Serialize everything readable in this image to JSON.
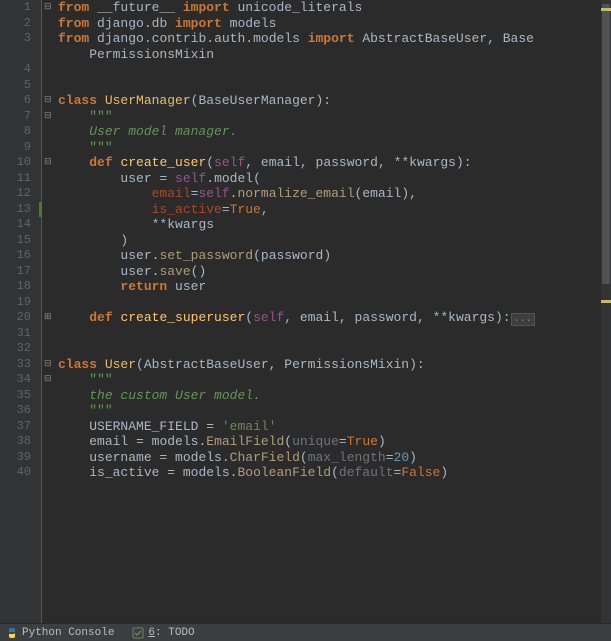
{
  "lines": [
    {
      "n": 1,
      "fold": "⊟",
      "tokens": [
        {
          "t": "from ",
          "c": "kw"
        },
        {
          "t": "__future__ ",
          "c": "ident"
        },
        {
          "t": "import ",
          "c": "kw"
        },
        {
          "t": "unicode_literals",
          "c": "ident"
        }
      ]
    },
    {
      "n": 2,
      "tokens": [
        {
          "t": "from ",
          "c": "kw"
        },
        {
          "t": "django",
          "c": "ident"
        },
        {
          "t": ".",
          "c": "dot"
        },
        {
          "t": "db ",
          "c": "ident"
        },
        {
          "t": "import ",
          "c": "kw"
        },
        {
          "t": "models",
          "c": "ident"
        }
      ]
    },
    {
      "n": 3,
      "tokens": [
        {
          "t": "from ",
          "c": "kw"
        },
        {
          "t": "django",
          "c": "ident"
        },
        {
          "t": ".",
          "c": "dot"
        },
        {
          "t": "contrib",
          "c": "ident"
        },
        {
          "t": ".",
          "c": "dot"
        },
        {
          "t": "auth",
          "c": "ident"
        },
        {
          "t": ".",
          "c": "dot"
        },
        {
          "t": "models ",
          "c": "ident"
        },
        {
          "t": "import ",
          "c": "kw"
        },
        {
          "t": "AbstractBaseUser",
          "c": "ident"
        },
        {
          "t": ", ",
          "c": "op"
        },
        {
          "t": "Base",
          "c": "ident"
        }
      ]
    },
    {
      "n": "",
      "indent": "    ",
      "tokens": [
        {
          "t": "PermissionsMixin",
          "c": "ident"
        }
      ]
    },
    {
      "n": 4,
      "tokens": []
    },
    {
      "n": 5,
      "tokens": []
    },
    {
      "n": 6,
      "fold": "⊟",
      "tokens": [
        {
          "t": "class ",
          "c": "kw"
        },
        {
          "t": "UserManager",
          "c": "cls-def"
        },
        {
          "t": "(",
          "c": "op"
        },
        {
          "t": "BaseUserManager",
          "c": "ident"
        },
        {
          "t": ")",
          "c": "op"
        },
        {
          "t": ":",
          "c": "op"
        }
      ]
    },
    {
      "n": 7,
      "fold": "⊟",
      "indent": "    ",
      "tokens": [
        {
          "t": "\"\"\"",
          "c": "docq"
        }
      ]
    },
    {
      "n": 8,
      "indent": "    ",
      "tokens": [
        {
          "t": "User model manager.",
          "c": "doc"
        }
      ]
    },
    {
      "n": 9,
      "indent": "    ",
      "tokens": [
        {
          "t": "\"\"\"",
          "c": "docq"
        }
      ]
    },
    {
      "n": 10,
      "fold": "⊟",
      "indent": "    ",
      "tokens": [
        {
          "t": "def ",
          "c": "kw"
        },
        {
          "t": "create_user",
          "c": "fn-def"
        },
        {
          "t": "(",
          "c": "op"
        },
        {
          "t": "self",
          "c": "self"
        },
        {
          "t": ", ",
          "c": "op"
        },
        {
          "t": "email",
          "c": "param"
        },
        {
          "t": ", ",
          "c": "op"
        },
        {
          "t": "password",
          "c": "param"
        },
        {
          "t": ", ",
          "c": "op"
        },
        {
          "t": "**",
          "c": "op"
        },
        {
          "t": "kwargs",
          "c": "param"
        },
        {
          "t": ")",
          "c": "op"
        },
        {
          "t": ":",
          "c": "op"
        }
      ]
    },
    {
      "n": 11,
      "indent": "        ",
      "tokens": [
        {
          "t": "user ",
          "c": "ident"
        },
        {
          "t": "= ",
          "c": "op"
        },
        {
          "t": "self",
          "c": "self"
        },
        {
          "t": ".",
          "c": "dot"
        },
        {
          "t": "model",
          "c": "ident"
        },
        {
          "t": "(",
          "c": "op"
        }
      ]
    },
    {
      "n": 12,
      "indent": "            ",
      "tokens": [
        {
          "t": "email",
          "c": "kwarg"
        },
        {
          "t": "=",
          "c": "op"
        },
        {
          "t": "self",
          "c": "self"
        },
        {
          "t": ".",
          "c": "dot"
        },
        {
          "t": "normalize_email",
          "c": "call"
        },
        {
          "t": "(",
          "c": "op"
        },
        {
          "t": "email",
          "c": "ident"
        },
        {
          "t": ")",
          "c": "op"
        },
        {
          "t": ",",
          "c": "op"
        }
      ]
    },
    {
      "n": 13,
      "change": true,
      "indent": "            ",
      "tokens": [
        {
          "t": "is_active",
          "c": "kwarg"
        },
        {
          "t": "=",
          "c": "op"
        },
        {
          "t": "True",
          "c": "kw-plain"
        },
        {
          "t": ",",
          "c": "op"
        }
      ]
    },
    {
      "n": 14,
      "indent": "            ",
      "tokens": [
        {
          "t": "**",
          "c": "op"
        },
        {
          "t": "kwargs",
          "c": "ident"
        }
      ]
    },
    {
      "n": 15,
      "indent": "        ",
      "tokens": [
        {
          "t": ")",
          "c": "op"
        }
      ]
    },
    {
      "n": 16,
      "indent": "        ",
      "tokens": [
        {
          "t": "user",
          "c": "ident"
        },
        {
          "t": ".",
          "c": "dot"
        },
        {
          "t": "set_password",
          "c": "call"
        },
        {
          "t": "(",
          "c": "op"
        },
        {
          "t": "password",
          "c": "ident"
        },
        {
          "t": ")",
          "c": "op"
        }
      ]
    },
    {
      "n": 17,
      "indent": "        ",
      "tokens": [
        {
          "t": "user",
          "c": "ident"
        },
        {
          "t": ".",
          "c": "dot"
        },
        {
          "t": "save",
          "c": "call"
        },
        {
          "t": "()",
          "c": "op"
        }
      ]
    },
    {
      "n": 18,
      "indent": "        ",
      "tokens": [
        {
          "t": "return ",
          "c": "kw"
        },
        {
          "t": "user",
          "c": "ident"
        }
      ]
    },
    {
      "n": 19,
      "tokens": []
    },
    {
      "n": 20,
      "fold": "⊞",
      "indent": "    ",
      "tokens": [
        {
          "t": "def ",
          "c": "kw"
        },
        {
          "t": "create_superuser",
          "c": "fn-def"
        },
        {
          "t": "(",
          "c": "op"
        },
        {
          "t": "self",
          "c": "self"
        },
        {
          "t": ", ",
          "c": "op"
        },
        {
          "t": "email",
          "c": "param"
        },
        {
          "t": ", ",
          "c": "op"
        },
        {
          "t": "password",
          "c": "param"
        },
        {
          "t": ", ",
          "c": "op"
        },
        {
          "t": "**",
          "c": "op"
        },
        {
          "t": "kwargs",
          "c": "param"
        },
        {
          "t": ")",
          "c": "op"
        },
        {
          "t": ":",
          "c": "op"
        }
      ],
      "folded": true
    },
    {
      "n": 31,
      "tokens": []
    },
    {
      "n": 32,
      "tokens": []
    },
    {
      "n": 33,
      "fold": "⊟",
      "tokens": [
        {
          "t": "class ",
          "c": "kw"
        },
        {
          "t": "User",
          "c": "cls-def"
        },
        {
          "t": "(",
          "c": "op"
        },
        {
          "t": "AbstractBaseUser",
          "c": "ident"
        },
        {
          "t": ", ",
          "c": "op"
        },
        {
          "t": "PermissionsMixin",
          "c": "ident"
        },
        {
          "t": ")",
          "c": "op"
        },
        {
          "t": ":",
          "c": "op"
        }
      ]
    },
    {
      "n": 34,
      "fold": "⊟",
      "indent": "    ",
      "tokens": [
        {
          "t": "\"\"\"",
          "c": "docq"
        }
      ]
    },
    {
      "n": 35,
      "indent": "    ",
      "tokens": [
        {
          "t": "the custom User model.",
          "c": "doc"
        }
      ]
    },
    {
      "n": 36,
      "indent": "    ",
      "tokens": [
        {
          "t": "\"\"\"",
          "c": "docq"
        }
      ]
    },
    {
      "n": 37,
      "indent": "    ",
      "tokens": [
        {
          "t": "USERNAME_FIELD ",
          "c": "ident"
        },
        {
          "t": "= ",
          "c": "op"
        },
        {
          "t": "'email'",
          "c": "str"
        }
      ]
    },
    {
      "n": 38,
      "indent": "    ",
      "tokens": [
        {
          "t": "email ",
          "c": "ident"
        },
        {
          "t": "= ",
          "c": "op"
        },
        {
          "t": "models",
          "c": "ident"
        },
        {
          "t": ".",
          "c": "dot"
        },
        {
          "t": "EmailField",
          "c": "call"
        },
        {
          "t": "(",
          "c": "op"
        },
        {
          "t": "unique",
          "c": "kwarg-p"
        },
        {
          "t": "=",
          "c": "op"
        },
        {
          "t": "True",
          "c": "kw-plain"
        },
        {
          "t": ")",
          "c": "op"
        }
      ]
    },
    {
      "n": 39,
      "indent": "    ",
      "tokens": [
        {
          "t": "username ",
          "c": "ident"
        },
        {
          "t": "= ",
          "c": "op"
        },
        {
          "t": "models",
          "c": "ident"
        },
        {
          "t": ".",
          "c": "dot"
        },
        {
          "t": "CharField",
          "c": "call"
        },
        {
          "t": "(",
          "c": "op"
        },
        {
          "t": "max_length",
          "c": "kwarg-p"
        },
        {
          "t": "=",
          "c": "op"
        },
        {
          "t": "20",
          "c": "num-bool"
        },
        {
          "t": ")",
          "c": "op"
        }
      ]
    },
    {
      "n": 40,
      "indent": "    ",
      "tokens": [
        {
          "t": "is_active ",
          "c": "ident"
        },
        {
          "t": "= ",
          "c": "op"
        },
        {
          "t": "models",
          "c": "ident"
        },
        {
          "t": ".",
          "c": "dot"
        },
        {
          "t": "BooleanField",
          "c": "call"
        },
        {
          "t": "(",
          "c": "op"
        },
        {
          "t": "default",
          "c": "kwarg-p"
        },
        {
          "t": "=",
          "c": "op"
        },
        {
          "t": "False",
          "c": "kw-plain"
        },
        {
          "t": ")",
          "c": "op"
        }
      ]
    }
  ],
  "status": {
    "pythonConsole": "Python Console",
    "todoKey": "6",
    "todoLabel": ": TODO"
  }
}
